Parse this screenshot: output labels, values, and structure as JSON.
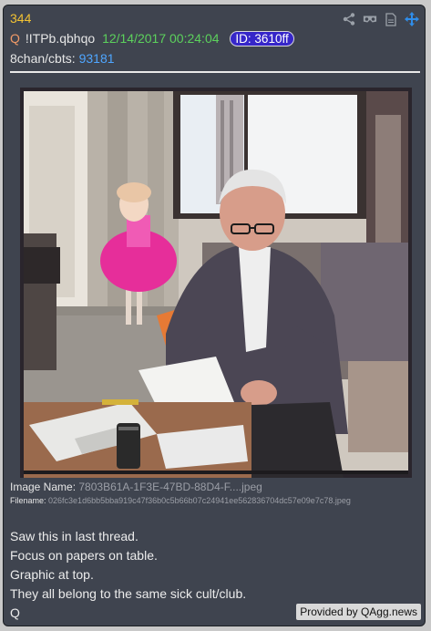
{
  "post": {
    "number": "344",
    "q_symbol": "Q",
    "tripcode": "!ITPb.qbhqo",
    "datetime": "12/14/2017 00:24:04",
    "id_badge": "ID: 3610ff",
    "board": "8chan/cbts:",
    "thread_number": "93181"
  },
  "icons": [
    "share-icon",
    "glasses-icon",
    "document-icon",
    "move-icon"
  ],
  "image": {
    "name_label": "Image Name:",
    "name_value": "7803B61A-1F3E-47BD-88D4-F....jpeg",
    "filename_label": "Filename:",
    "filename_value": "026fc3e1d6bb5bba919c47f36b0c5b66b07c24941ee562836704dc57e09e7c78.jpeg"
  },
  "message": {
    "lines": [
      "Saw this in last thread.",
      "Focus on papers on table.",
      "Graphic at top.",
      "They all belong to the same sick cult/club.",
      "Q"
    ]
  },
  "credit": "Provided by QAgg.news",
  "colors": {
    "card_bg": "#3f444f",
    "post_number": "#f2c233",
    "q_symbol": "#f09a68",
    "date": "#5cd15c",
    "id_badge_bg": "#3626c9",
    "thread_link": "#4fa6ff"
  }
}
